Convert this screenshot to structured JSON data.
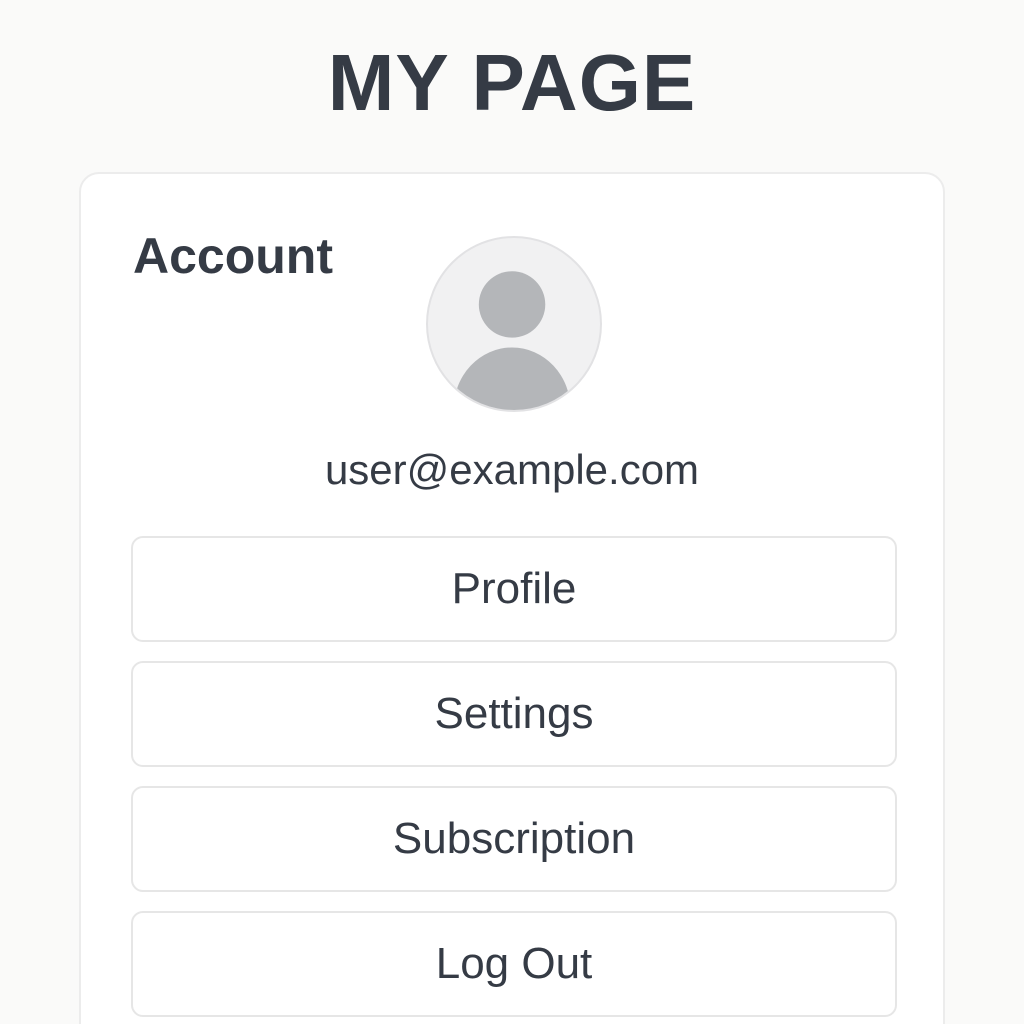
{
  "page": {
    "title": "MY PAGE"
  },
  "account": {
    "section_title": "Account",
    "avatar_icon": "user-avatar-icon",
    "email": "user@example.com"
  },
  "menu": {
    "items": [
      {
        "label": "Profile"
      },
      {
        "label": "Settings"
      },
      {
        "label": "Subscription"
      },
      {
        "label": "Log Out"
      }
    ]
  },
  "colors": {
    "background": "#fafaf9",
    "card": "#ffffff",
    "text": "#353b45",
    "border": "#e6e6e6",
    "avatar_bg": "#f1f1f2",
    "avatar_fg": "#b4b6b9"
  }
}
